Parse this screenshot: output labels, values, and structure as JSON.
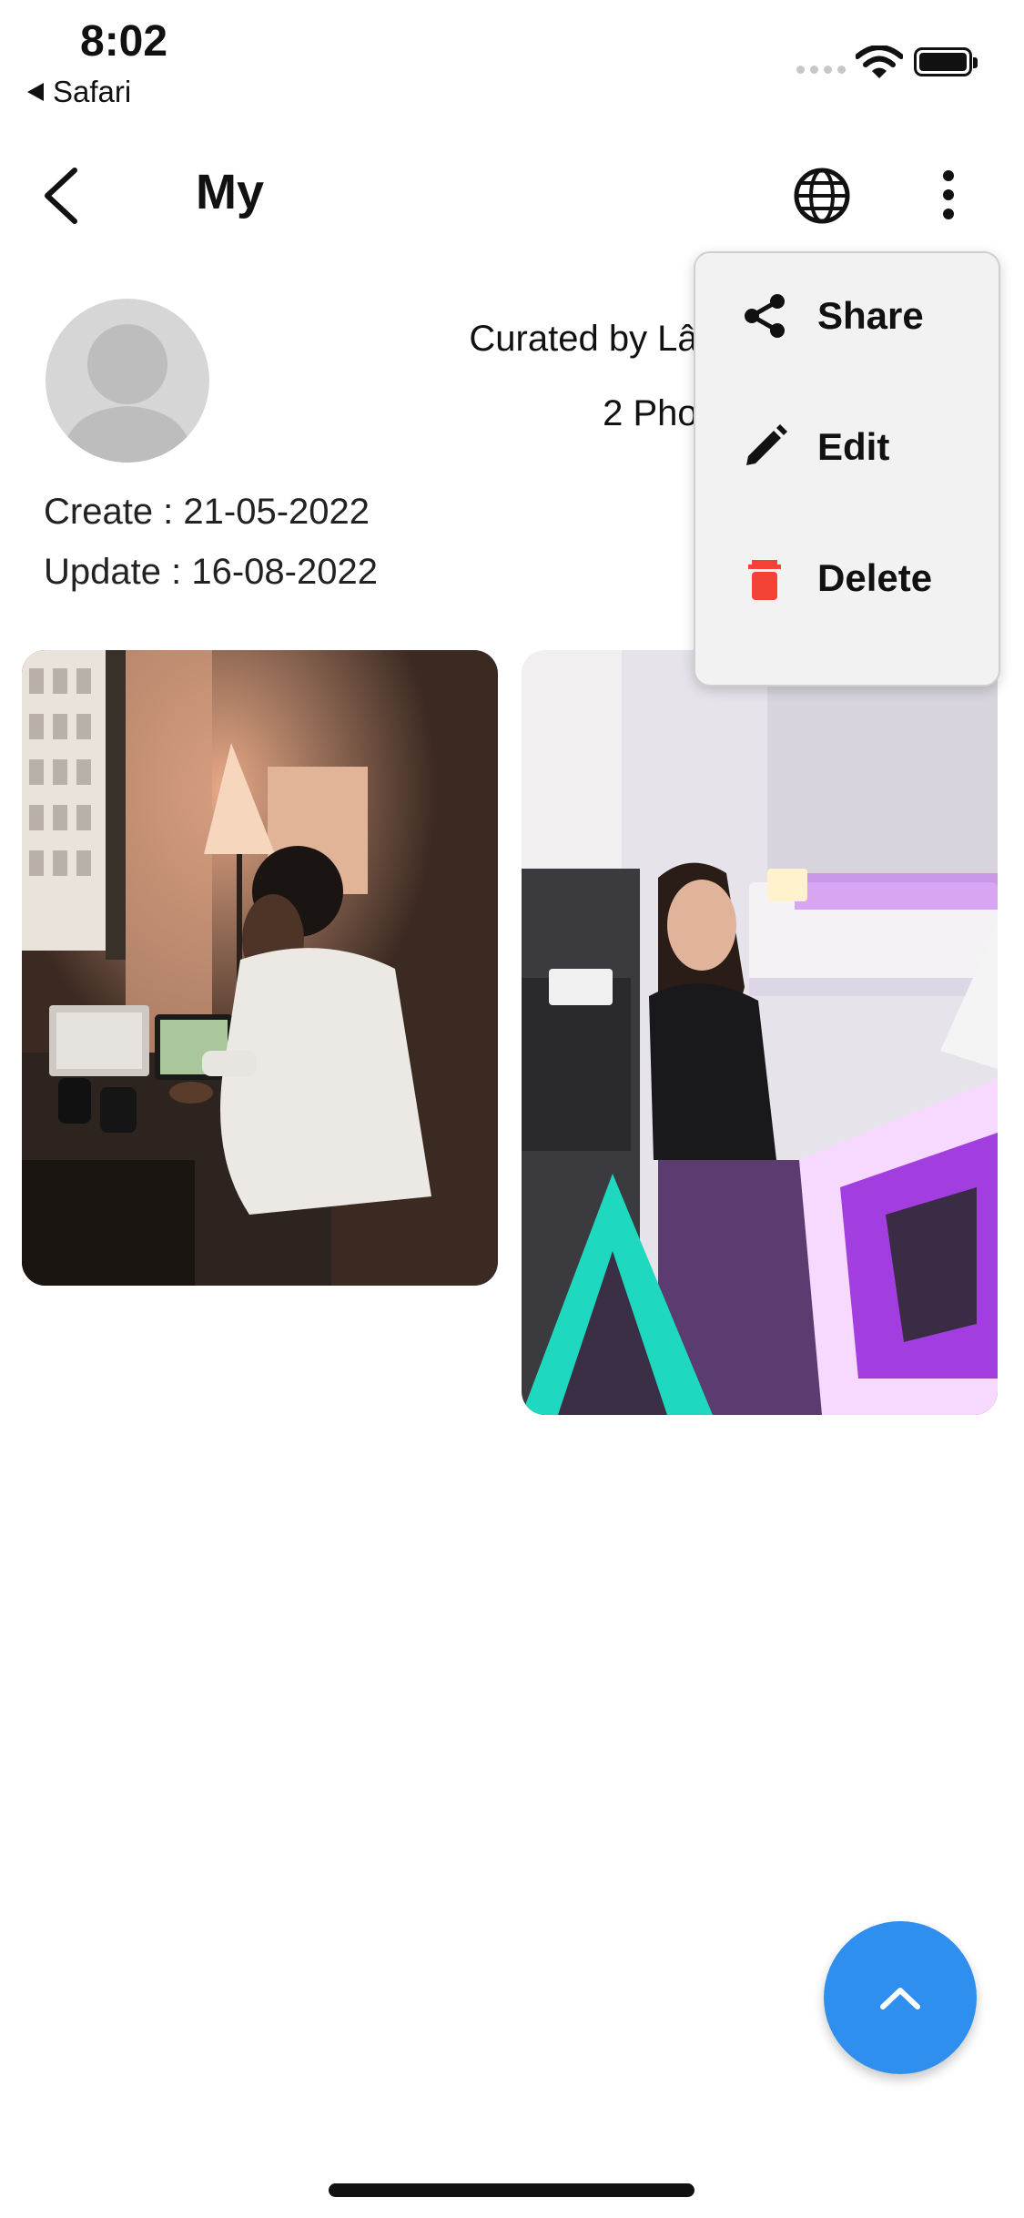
{
  "status_bar": {
    "time": "8:02",
    "back_app": "Safari",
    "icons": [
      "signal-dots-icon",
      "wifi-icon",
      "battery-icon"
    ]
  },
  "app_bar": {
    "title": "My",
    "icons": [
      "back-arrow-icon",
      "globe-icon",
      "more-vert-icon"
    ]
  },
  "profile": {
    "curated_by": "Curated by Lâm",
    "photo_count": "2 Photo",
    "created": "Create : 21-05-2022",
    "updated": "Update : 16-08-2022"
  },
  "photos": [
    {
      "name": "man-at-desk-with-laptop-photo",
      "colors": [
        "#2c211b",
        "#c98b64"
      ]
    },
    {
      "name": "woman-gaming-neon-photo",
      "colors": [
        "#d9d2e2",
        "#9b4fd8"
      ]
    }
  ],
  "menu": {
    "items": [
      {
        "label": "Share",
        "icon": "share-icon",
        "color": "#111111"
      },
      {
        "label": "Edit",
        "icon": "edit-pencil-icon",
        "color": "#111111"
      },
      {
        "label": "Delete",
        "icon": "trash-icon",
        "color": "#f44336"
      }
    ]
  },
  "fab": {
    "icon": "chevron-up-icon",
    "color": "#2f8fef"
  }
}
